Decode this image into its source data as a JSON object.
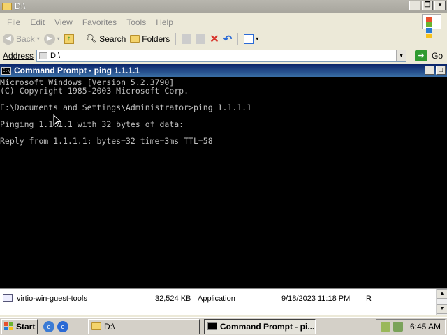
{
  "explorer": {
    "title": "D:\\",
    "menu": [
      "File",
      "Edit",
      "View",
      "Favorites",
      "Tools",
      "Help"
    ],
    "toolbar": {
      "back": "Back",
      "search": "Search",
      "folders": "Folders"
    },
    "address_label": "Address",
    "address_value": "D:\\",
    "go_label": "Go"
  },
  "cmd": {
    "title": "Command Prompt - ping 1.1.1.1",
    "icon_text": "C:\\",
    "lines": [
      "Microsoft Windows [Version 5.2.3790]",
      "(C) Copyright 1985-2003 Microsoft Corp.",
      "",
      "E:\\Documents and Settings\\Administrator>ping 1.1.1.1",
      "",
      "Pinging 1.1.1.1 with 32 bytes of data:",
      "",
      "Reply from 1.1.1.1: bytes=32 time=3ms TTL=58"
    ]
  },
  "filelist": {
    "row": {
      "name": "virtio-win-guest-tools",
      "size": "32,524 KB",
      "type": "Application",
      "modified": "9/18/2023 11:18 PM",
      "attributes": "R"
    }
  },
  "taskbar": {
    "start": "Start",
    "tasks": [
      "D:\\",
      "Command Prompt - pi..."
    ],
    "clock": "6:45 AM"
  },
  "colors": {
    "cmd_bg": "#000000",
    "cmd_text": "#c0c0c0",
    "titlebar_active": "#0a246a"
  }
}
